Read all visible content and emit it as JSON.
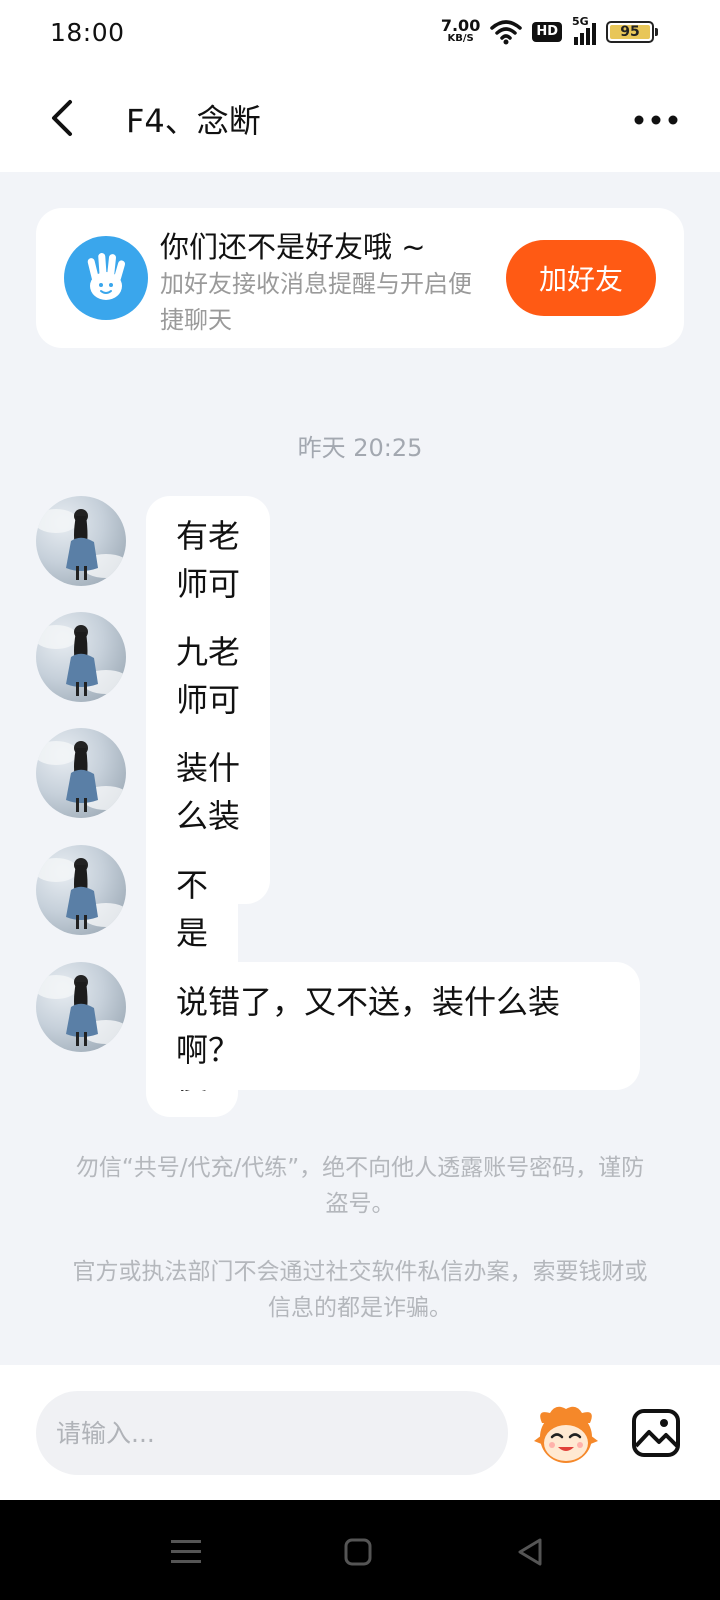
{
  "status_bar": {
    "time": "18:00",
    "net_speed_value": "7.00",
    "net_speed_unit": "KB/S",
    "hd_label": "HD",
    "signal_label": "5G",
    "battery_level": "95"
  },
  "header": {
    "title": "F4、念断"
  },
  "friend_card": {
    "title": "你们还不是好友哦 ~",
    "subtitle": "加好友接收消息提醒与开启便捷聊天",
    "button_label": "加好友"
  },
  "timestamp": "昨天 20:25",
  "messages": [
    {
      "text": "有老师可以送吗？"
    },
    {
      "text": "九老师可以送吗？"
    },
    {
      "text": "装什么装啊？"
    },
    {
      "text": "不是我装傻"
    },
    {
      "text": "说错了，又不送，装什么装啊？"
    }
  ],
  "warnings": [
    "勿信“共号/代充/代练”，绝不向他人透露账号密码，谨防盗号。",
    "官方或执法部门不会通过社交软件私信办案，索要钱财或信息的都是诈骗。"
  ],
  "input": {
    "placeholder": "请输入..."
  },
  "colors": {
    "accent": "#ff5a14",
    "logo": "#3aa6ec",
    "background": "#f2f4f8"
  }
}
